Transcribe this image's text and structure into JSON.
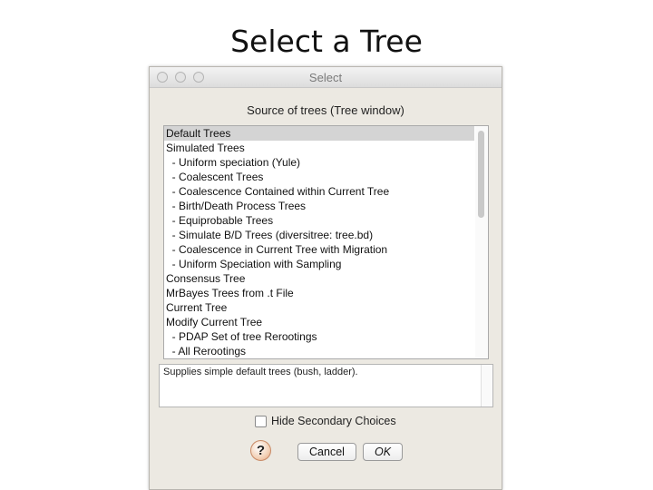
{
  "slide": {
    "title": "Select a Tree"
  },
  "window": {
    "title": "Select"
  },
  "dialog": {
    "header": "Source of trees (Tree window)",
    "items": [
      "Default Trees",
      "Simulated Trees",
      "  - Uniform speciation (Yule)",
      "  - Coalescent Trees",
      "  - Coalescence Contained within Current Tree",
      "  - Birth/Death Process Trees",
      "  - Equiprobable Trees",
      "  - Simulate B/D Trees (diversitree: tree.bd)",
      "  - Coalescence in Current Tree with Migration",
      "  - Uniform Speciation with Sampling",
      "Consensus Tree",
      "MrBayes Trees from .t File",
      "Current Tree",
      "Modify Current Tree",
      "  - PDAP Set of tree Rerootings",
      "  - All Rerootings"
    ],
    "selected_index": 0,
    "description": "Supplies simple default trees (bush, ladder).",
    "hide_secondary_label": "Hide Secondary Choices",
    "hide_secondary_checked": false,
    "help_label": "?",
    "cancel_label": "Cancel",
    "ok_label": "OK"
  }
}
